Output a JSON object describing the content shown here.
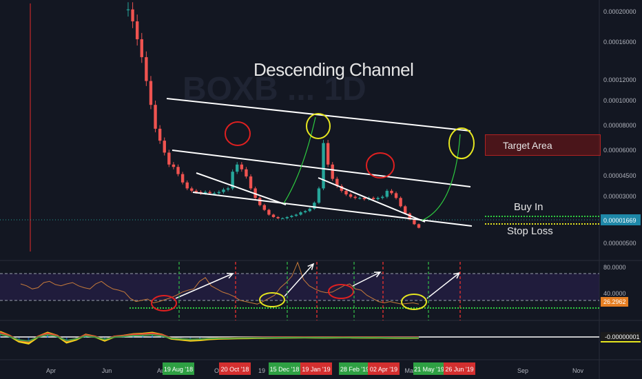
{
  "chart_data": [
    {
      "type": "line",
      "title": "Descending Channel",
      "watermark": "BOXB ... 1D",
      "colors": {
        "up": "#26a69a",
        "down": "#ef5350",
        "annotation_line": "#ffffff",
        "circle_red": "#e02020",
        "circle_yellow": "#e6e620",
        "projection": "#2ecc40"
      },
      "y_ticks": [
        "0.00020000",
        "0.00016000",
        "0.00012000",
        "0.00010000",
        "0.00008000",
        "0.00006000",
        "0.00004500",
        "0.00003000",
        "0.00000500"
      ],
      "current_price": "0.00001669",
      "annotations": {
        "target": "Target Area",
        "buy": "Buy In",
        "stop": "Stop Loss"
      },
      "series": [
        {
          "values": [
            0.0002,
            0.00019,
            0.000175,
            0.00016,
            0.00014,
            0.00012,
            0.0001,
            9e-05,
            8e-05,
            7e-05,
            6.8e-05,
            6.2e-05,
            5.5e-05,
            5e-05,
            4.8e-05,
            4.7e-05,
            4.6e-05,
            4.7e-05,
            4.6e-05,
            4.6e-05,
            4.7e-05,
            4.9e-05,
            5e-05,
            6.4e-05,
            7e-05,
            6.6e-05,
            6e-05,
            5e-05,
            4.2e-05,
            3.6e-05,
            3.2e-05,
            2.8e-05,
            2.6e-05,
            2.5e-05,
            2.5e-05,
            2.6e-05,
            2.7e-05,
            2.8e-05,
            3e-05,
            3.1e-05,
            3.3e-05,
            3.8e-05,
            5e-05,
            8.8e-05,
            7e-05,
            5.8e-05,
            5.2e-05,
            4.8e-05,
            4.5e-05,
            4.3e-05,
            4.2e-05,
            4.2e-05,
            4.1e-05,
            4.2e-05,
            4.1e-05,
            4.2e-05,
            4.3e-05,
            4.8e-05,
            4.6e-05,
            4.2e-05,
            3.5e-05,
            2.9e-05,
            2.4e-05,
            2e-05,
            1.7e-05
          ]
        }
      ]
    },
    {
      "type": "line",
      "y_ticks": [
        "80.0000",
        "40.0000"
      ],
      "current_value": "26.2962",
      "series": [
        {
          "values": [
            58,
            55,
            50,
            52,
            60,
            62,
            57,
            55,
            58,
            60,
            55,
            52,
            50,
            58,
            62,
            55,
            50,
            48,
            45,
            35,
            30,
            32,
            34,
            28,
            30,
            33,
            36,
            40,
            45,
            48,
            50,
            62,
            68,
            55,
            50,
            45,
            42,
            38,
            32,
            30,
            28,
            26,
            30,
            35,
            40,
            52,
            60,
            70,
            92,
            65,
            55,
            50,
            46,
            44,
            45,
            50,
            55,
            58,
            50,
            48,
            40,
            35,
            30,
            28,
            30,
            28,
            26,
            27,
            28,
            26
          ]
        }
      ]
    },
    {
      "type": "line",
      "current_value": "-0.00000001",
      "series": [
        {
          "values": [
            0.6,
            0.2,
            -0.4,
            -0.6,
            0.1,
            0.5,
            0.2,
            -0.5,
            -0.2,
            0.3,
            0.1,
            -0.3,
            0.1,
            0.2,
            0.35,
            0.4,
            0.5,
            0.3,
            -0.1,
            -0.2,
            -0.3,
            -0.25,
            -0.15,
            -0.1,
            -0.08,
            -0.05,
            -0.04,
            -0.03,
            -0.02,
            0,
            0.01,
            0.02,
            0.03,
            0.02,
            0.01,
            0.02,
            0.03,
            0.02,
            0.01,
            0.02,
            0.01,
            -0.01,
            -0.02,
            -0.02,
            -0.01
          ]
        }
      ]
    },
    {
      "type": "line",
      "x_ticks": [
        "Apr",
        "Jun",
        "Aug",
        "Oct",
        "19",
        "Mar",
        "May",
        "Sep",
        "Nov"
      ],
      "date_labels": [
        {
          "text": "19 Aug '18",
          "color": "#2ea043"
        },
        {
          "text": "20 Oct '18",
          "color": "#d32f2f"
        },
        {
          "text": "15 Dec '18",
          "color": "#2ea043"
        },
        {
          "text": "19 Jan '19",
          "color": "#d32f2f"
        },
        {
          "text": "28 Feb '19",
          "color": "#2ea043"
        },
        {
          "text": "02 Apr '19",
          "color": "#d32f2f"
        },
        {
          "text": "21 May '19",
          "color": "#2ea043"
        },
        {
          "text": "26 Jun '19",
          "color": "#d32f2f"
        }
      ]
    }
  ]
}
